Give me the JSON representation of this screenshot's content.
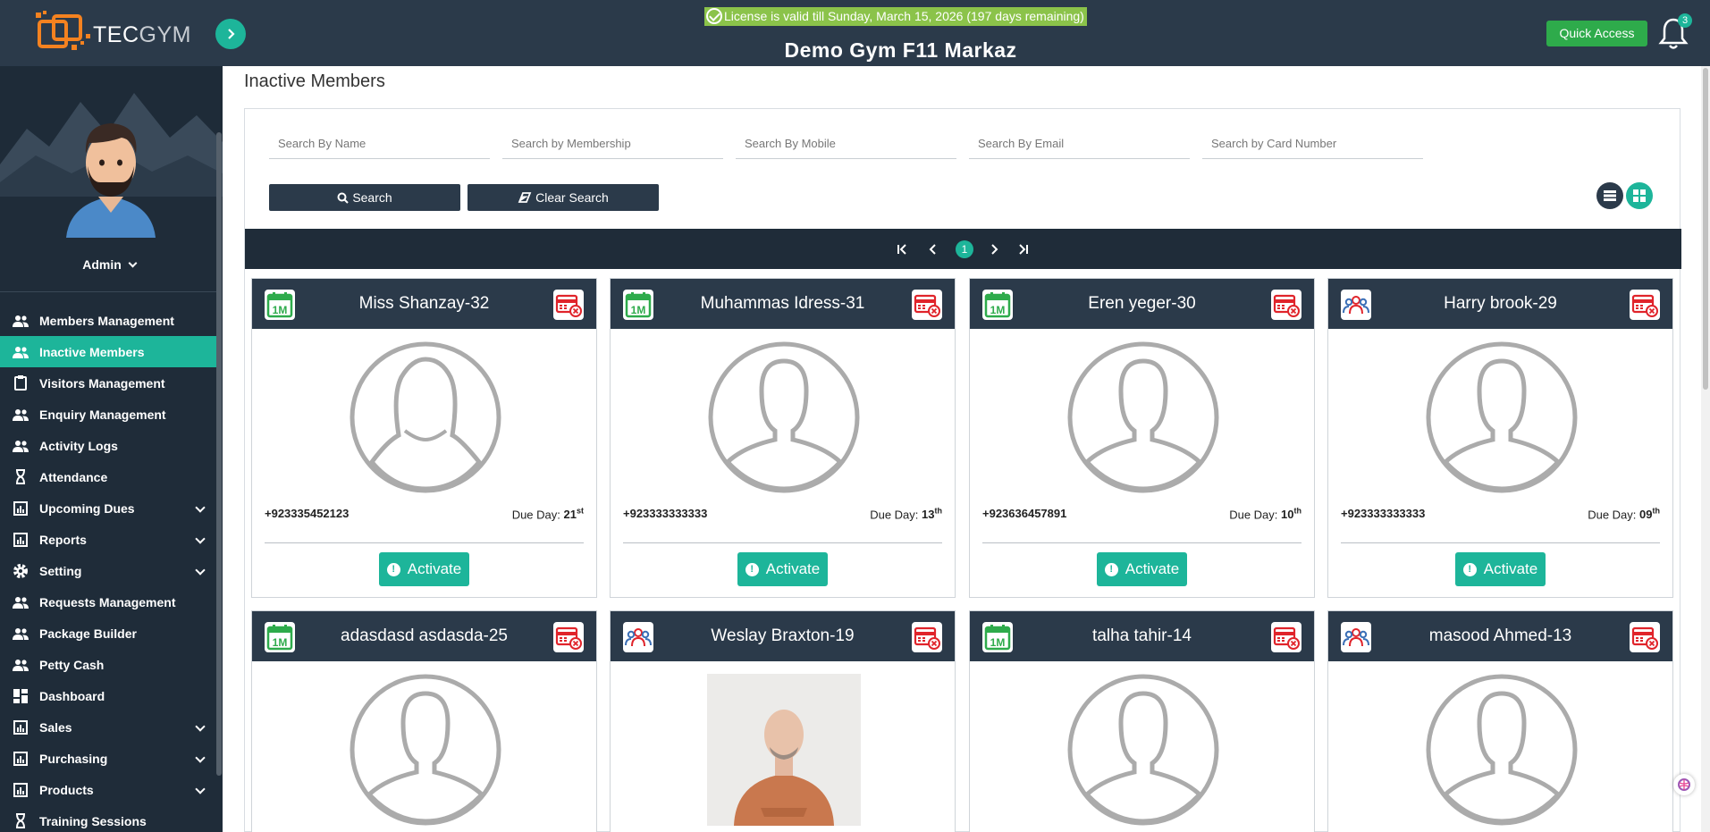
{
  "app": {
    "logo_tec": "TEC",
    "logo_gym": "GYM",
    "license_text": "License is valid till Sunday, March 15, 2026 (197 days remaining)",
    "gym_name": "Demo Gym F11 Markaz",
    "quick_access_label": "Quick Access",
    "notification_count": "3"
  },
  "sidebar": {
    "user_label": "Admin",
    "items": [
      {
        "label": "Members Management",
        "icon": "people-icon",
        "expandable": false,
        "active": false
      },
      {
        "label": "Inactive Members",
        "icon": "people-icon",
        "expandable": false,
        "active": true
      },
      {
        "label": "Visitors Management",
        "icon": "clipboard-icon",
        "expandable": false,
        "active": false
      },
      {
        "label": "Enquiry Management",
        "icon": "people-icon",
        "expandable": false,
        "active": false
      },
      {
        "label": "Activity Logs",
        "icon": "people-icon",
        "expandable": false,
        "active": false
      },
      {
        "label": "Attendance",
        "icon": "hourglass-icon",
        "expandable": false,
        "active": false
      },
      {
        "label": "Upcoming Dues",
        "icon": "bar-chart-icon",
        "expandable": true,
        "active": false
      },
      {
        "label": "Reports",
        "icon": "bar-chart-icon",
        "expandable": true,
        "active": false
      },
      {
        "label": "Setting",
        "icon": "gear-icon",
        "expandable": true,
        "active": false
      },
      {
        "label": "Requests Management",
        "icon": "people-icon",
        "expandable": false,
        "active": false
      },
      {
        "label": "Package Builder",
        "icon": "people-icon",
        "expandable": false,
        "active": false
      },
      {
        "label": "Petty Cash",
        "icon": "people-icon",
        "expandable": false,
        "active": false
      },
      {
        "label": "Dashboard",
        "icon": "dashboard-icon",
        "expandable": false,
        "active": false
      },
      {
        "label": "Sales",
        "icon": "bar-chart-icon",
        "expandable": true,
        "active": false
      },
      {
        "label": "Purchasing",
        "icon": "bar-chart-icon",
        "expandable": true,
        "active": false
      },
      {
        "label": "Products",
        "icon": "bar-chart-icon",
        "expandable": true,
        "active": false
      },
      {
        "label": "Training Sessions",
        "icon": "hourglass-icon",
        "expandable": false,
        "active": false
      }
    ]
  },
  "main": {
    "page_title": "Inactive Members",
    "search": {
      "name_placeholder": "Search By Name",
      "membership_placeholder": "Search by Membership",
      "mobile_placeholder": "Search By Mobile",
      "email_placeholder": "Search By Email",
      "card_placeholder": "Search by Card Number",
      "search_label": "Search",
      "clear_label": "Clear Search"
    },
    "pagination": {
      "current_page": "1"
    },
    "activate_label": "Activate",
    "due_label": "Due Day:",
    "members": [
      {
        "name": "Miss Shanzay-32",
        "phone": "+923335452123",
        "due_day": "21",
        "due_suffix": "st",
        "left_badge": "calendar-1m-icon",
        "photo": "female-avatar-icon"
      },
      {
        "name": "Muhammas Idress-31",
        "phone": "+923333333333",
        "due_day": "13",
        "due_suffix": "th",
        "left_badge": "calendar-1m-icon",
        "photo": "male-avatar-icon"
      },
      {
        "name": "Eren yeger-30",
        "phone": "+923636457891",
        "due_day": "10",
        "due_suffix": "th",
        "left_badge": "calendar-1m-icon",
        "photo": "male-avatar-icon"
      },
      {
        "name": "Harry brook-29",
        "phone": "+923333333333",
        "due_day": "09",
        "due_suffix": "th",
        "left_badge": "group-icon",
        "photo": "male-avatar-icon"
      },
      {
        "name": "adasdasd asdasda-25",
        "left_badge": "calendar-1m-icon",
        "photo": "male-avatar-icon"
      },
      {
        "name": "Weslay Braxton-19",
        "left_badge": "group-icon",
        "photo": "member-photo"
      },
      {
        "name": "talha tahir-14",
        "left_badge": "calendar-1m-icon",
        "photo": "male-avatar-icon"
      },
      {
        "name": "masood Ahmed-13",
        "left_badge": "group-icon",
        "photo": "male-avatar-icon"
      }
    ]
  },
  "colors": {
    "accent": "#1db59a",
    "header": "#2b3a4a",
    "sidebar": "#1f2c39",
    "license_bg": "#8bc34a",
    "quick_access": "#2eab4b",
    "badge_red": "#e0242b",
    "badge_green": "#2eab4b"
  }
}
